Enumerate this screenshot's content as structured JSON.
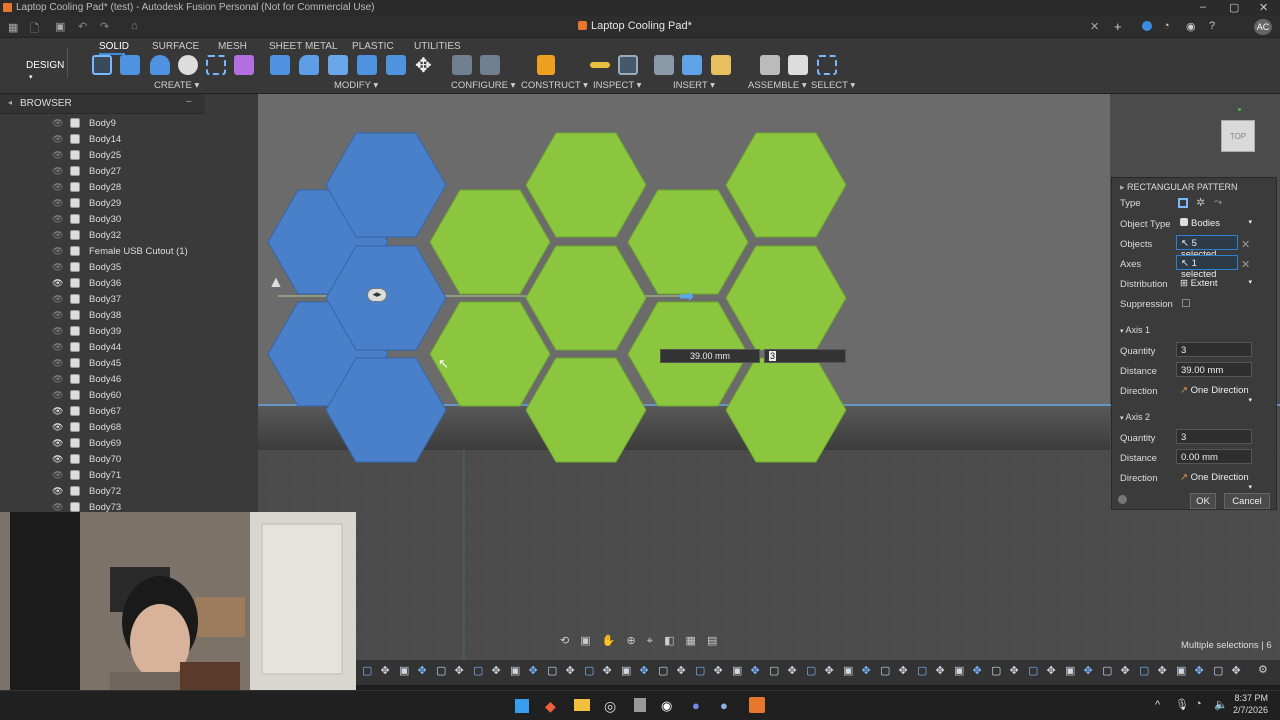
{
  "window": {
    "title": "Laptop Cooling Pad* (test) - Autodesk Fusion Personal (Not for Commercial Use)",
    "document_tab": "Laptop Cooling Pad*",
    "user_initials": "AC"
  },
  "toolbar": {
    "workspace": "DESIGN",
    "tabs": [
      "SOLID",
      "SURFACE",
      "MESH",
      "SHEET METAL",
      "PLASTIC",
      "UTILITIES"
    ],
    "active_tab": "SOLID",
    "groups": [
      "CREATE",
      "MODIFY",
      "CONFIGURE",
      "CONSTRUCT",
      "INSPECT",
      "INSERT",
      "ASSEMBLE",
      "SELECT"
    ]
  },
  "browser": {
    "title": "BROWSER",
    "items": [
      {
        "label": "Body9",
        "visible": false
      },
      {
        "label": "Body14",
        "visible": false
      },
      {
        "label": "Body25",
        "visible": false
      },
      {
        "label": "Body27",
        "visible": false
      },
      {
        "label": "Body28",
        "visible": false
      },
      {
        "label": "Body29",
        "visible": false
      },
      {
        "label": "Body30",
        "visible": false
      },
      {
        "label": "Body32",
        "visible": false
      },
      {
        "label": "Female USB Cutout (1)",
        "visible": false
      },
      {
        "label": "Body35",
        "visible": false
      },
      {
        "label": "Body36",
        "visible": true
      },
      {
        "label": "Body37",
        "visible": false
      },
      {
        "label": "Body38",
        "visible": false
      },
      {
        "label": "Body39",
        "visible": false
      },
      {
        "label": "Body44",
        "visible": false
      },
      {
        "label": "Body45",
        "visible": false
      },
      {
        "label": "Body46",
        "visible": false
      },
      {
        "label": "Body60",
        "visible": false
      },
      {
        "label": "Body67",
        "visible": true
      },
      {
        "label": "Body68",
        "visible": true
      },
      {
        "label": "Body69",
        "visible": true
      },
      {
        "label": "Body70",
        "visible": true
      },
      {
        "label": "Body71",
        "visible": false
      },
      {
        "label": "Body72",
        "visible": true
      },
      {
        "label": "Body73",
        "visible": false
      }
    ]
  },
  "viewport": {
    "viewcube_label": "TOP",
    "distance_input": "39.00 mm",
    "quantity_input": "3",
    "status": "Multiple selections | 6",
    "colors": {
      "selected_body": "#4a7fc9",
      "preview_body": "#8cc63f",
      "background": "#4b4b4b"
    }
  },
  "pattern_panel": {
    "title": "RECTANGULAR PATTERN",
    "type_label": "Type",
    "object_type_label": "Object Type",
    "object_type_value": "Bodies",
    "objects_label": "Objects",
    "objects_value": "5 selected",
    "axes_label": "Axes",
    "axes_value": "1 selected",
    "distribution_label": "Distribution",
    "distribution_value": "Extent",
    "suppression_label": "Suppression",
    "axis1": {
      "title": "Axis 1",
      "quantity_label": "Quantity",
      "quantity": "3",
      "distance_label": "Distance",
      "distance": "39.00 mm",
      "direction_label": "Direction",
      "direction": "One Direction"
    },
    "axis2": {
      "title": "Axis 2",
      "quantity_label": "Quantity",
      "quantity": "3",
      "distance_label": "Distance",
      "distance": "0.00 mm",
      "direction_label": "Direction",
      "direction": "One Direction"
    },
    "ok": "OK",
    "cancel": "Cancel"
  },
  "taskbar": {
    "time": "8:37 PM",
    "date": "2/7/2026"
  }
}
